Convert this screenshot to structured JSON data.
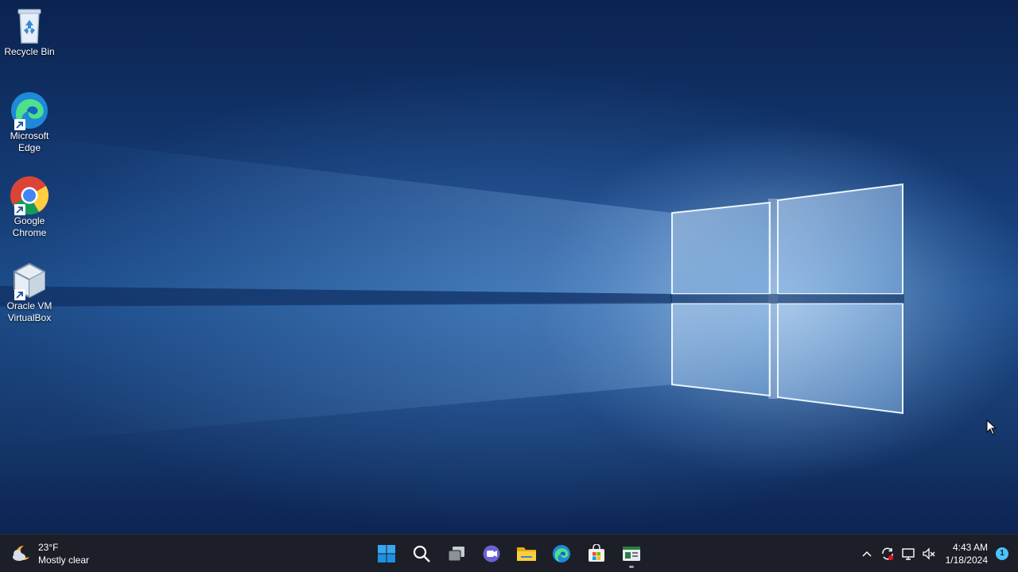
{
  "desktop": {
    "icons": [
      {
        "label": "Recycle Bin",
        "icon": "recycle-bin-icon"
      },
      {
        "label": "Microsoft Edge",
        "icon": "edge-icon"
      },
      {
        "label": "Google Chrome",
        "icon": "chrome-icon"
      },
      {
        "label": "Oracle VM VirtualBox",
        "icon": "virtualbox-icon"
      }
    ],
    "wallpaper": "windows-10-light-window"
  },
  "taskbar": {
    "weather": {
      "temp": "23°F",
      "condition": "Mostly clear",
      "icon": "weather-partly-cloudy-night-icon"
    },
    "apps": [
      {
        "name": "Start",
        "icon": "windows-start-icon"
      },
      {
        "name": "Search",
        "icon": "search-icon"
      },
      {
        "name": "Task View",
        "icon": "task-view-icon"
      },
      {
        "name": "Chat",
        "icon": "teams-chat-icon"
      },
      {
        "name": "File Explorer",
        "icon": "file-explorer-icon"
      },
      {
        "name": "Microsoft Edge",
        "icon": "edge-icon"
      },
      {
        "name": "Microsoft Store",
        "icon": "store-icon"
      },
      {
        "name": "Open window",
        "icon": "app-window-icon",
        "active": true
      }
    ],
    "tray": {
      "icons": [
        "chevron-up-icon",
        "sync-icon",
        "network-icon",
        "volume-muted-icon"
      ],
      "time": "4:43 AM",
      "date": "1/18/2024",
      "notification_count": "1"
    }
  },
  "colors": {
    "taskbar_bg": "#1c1f27",
    "accent": "#4cc2ff"
  }
}
